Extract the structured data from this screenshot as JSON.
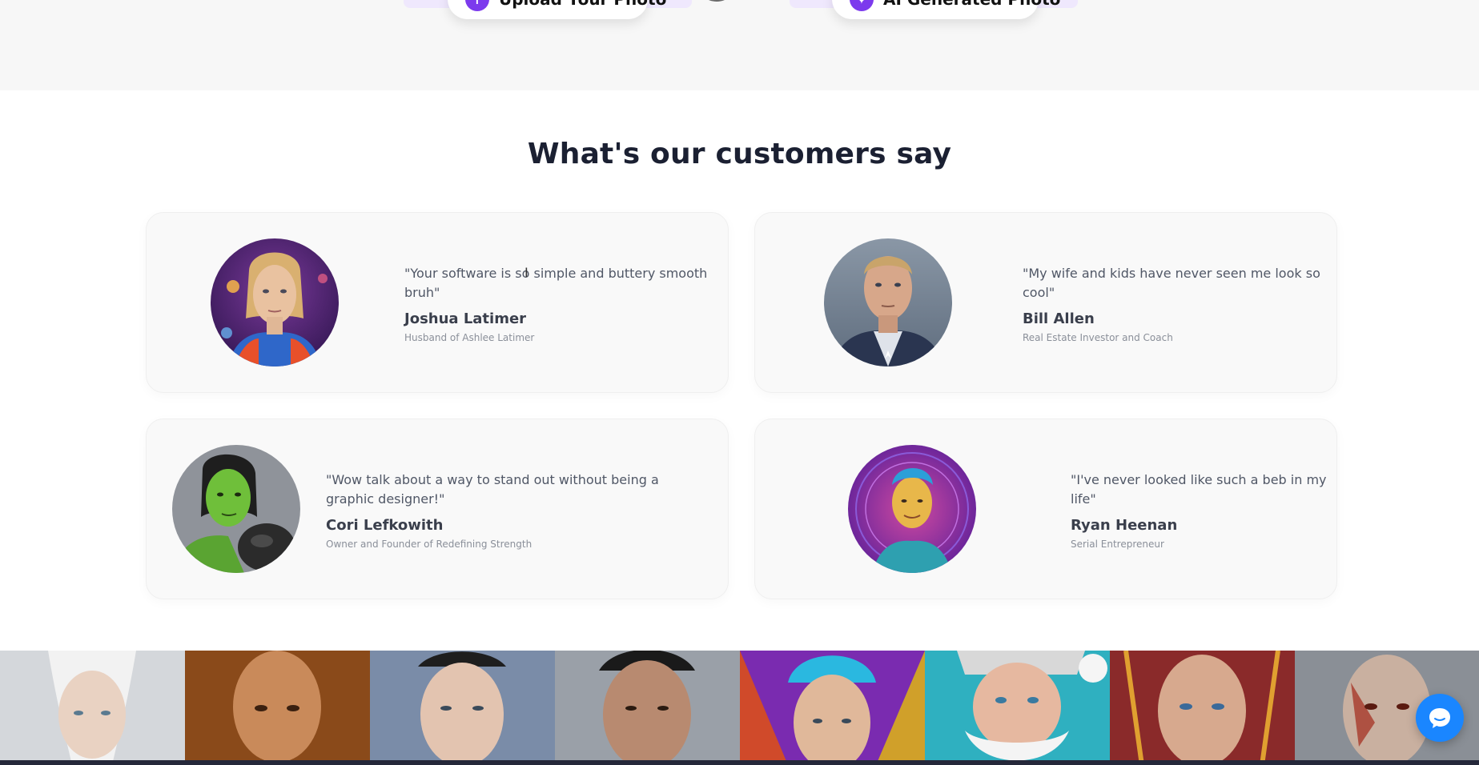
{
  "top_buttons": {
    "upload_label": "Upload Your Photo",
    "upload_icon": "↑",
    "ai_label": "AI Generated Photo",
    "ai_icon": "✦"
  },
  "section_title": "What's our customers say",
  "testimonials": [
    {
      "quote": "\"Your software is so simple and buttery smooth bruh\"",
      "name": "Joshua Latimer",
      "role": "Husband of Ashlee Latimer",
      "avatar_icon": "woman-astronaut-portrait"
    },
    {
      "quote": "\"My wife and kids have never seen me look so cool\"",
      "name": "Bill Allen",
      "role": "Real Estate Investor and Coach",
      "avatar_icon": "superhero-man-portrait"
    },
    {
      "quote": "\"Wow talk about a way to stand out without being a graphic designer!\"",
      "name": "Cori Lefkowith",
      "role": "Owner and Founder of Redefining Strength",
      "avatar_icon": "green-hulk-woman-portrait"
    },
    {
      "quote": "\"I've never looked like such a beb in my life\"",
      "name": "Ryan Heenan",
      "role": "Serial Entrepreneur",
      "avatar_icon": "psychedelic-man-portrait"
    }
  ],
  "gallery": [
    {
      "icon": "elf-portrait",
      "bg": "#c9cdd2"
    },
    {
      "icon": "mobster-portrait",
      "bg": "#8a4a1a"
    },
    {
      "icon": "fighter-portrait",
      "bg": "#7a8ca8"
    },
    {
      "icon": "gangster-portrait",
      "bg": "#9aa0a8"
    },
    {
      "icon": "neon-hair-portrait",
      "bg": "#7a2bb0"
    },
    {
      "icon": "santa-portrait",
      "bg": "#2fb0c0"
    },
    {
      "icon": "superhero-portrait",
      "bg": "#8a2a2a"
    },
    {
      "icon": "zombie-portrait",
      "bg": "#8a8f96"
    }
  ],
  "colors": {
    "accent": "#7c3aed",
    "chat": "#1a86ff",
    "title": "#1b2032"
  }
}
